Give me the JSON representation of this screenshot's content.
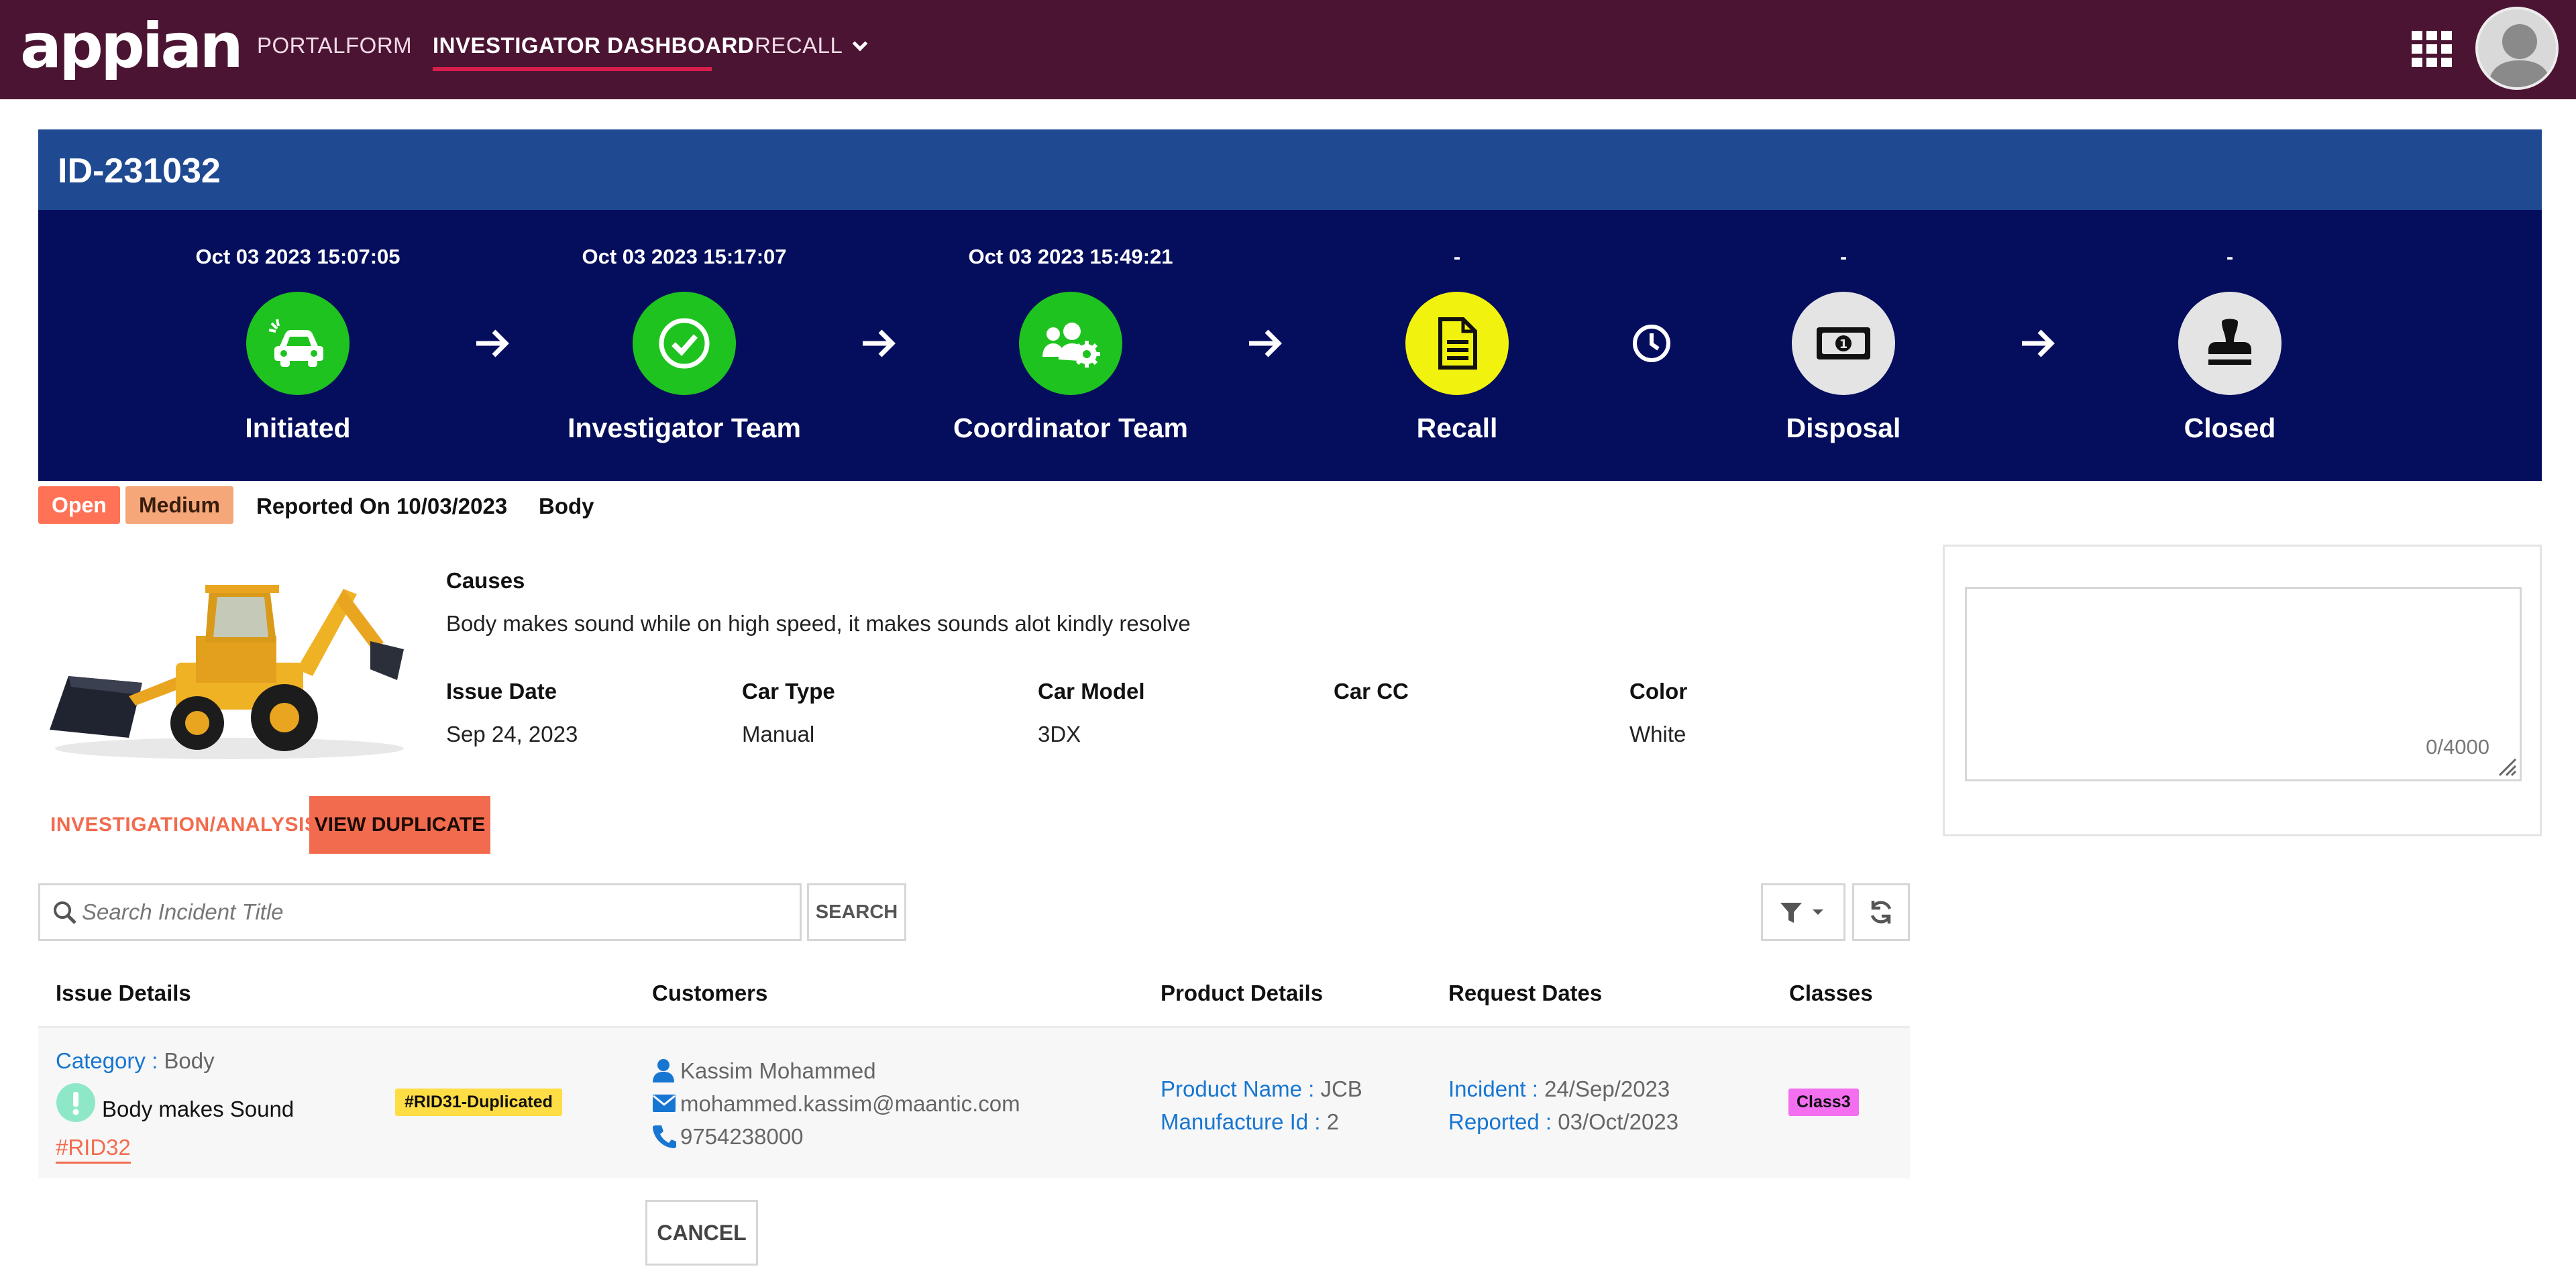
{
  "nav": {
    "logo": "appian",
    "items": [
      {
        "label": "PORTALFORM"
      },
      {
        "label": "INVESTIGATOR DASHBOARD"
      },
      {
        "label": "RECALL"
      }
    ]
  },
  "record": {
    "id": "ID-231032"
  },
  "timeline": {
    "steps": [
      {
        "date": "Oct 03 2023 15:07:05",
        "label": "Initiated",
        "icon": "car-crash-icon",
        "color": "#1fc31f"
      },
      {
        "date": "Oct 03 2023 15:17:07",
        "label": "Investigator Team",
        "icon": "check-circle-icon",
        "color": "#1fc31f"
      },
      {
        "date": "Oct 03 2023 15:49:21",
        "label": "Coordinator Team",
        "icon": "users-gear-icon",
        "color": "#1fc31f"
      },
      {
        "date": "-",
        "label": "Recall",
        "icon": "document-icon",
        "color": "#f2f20f"
      },
      {
        "date": "-",
        "label": "Disposal",
        "icon": "money-icon",
        "color": "#e4e4e4"
      },
      {
        "date": "-",
        "label": "Closed",
        "icon": "stamp-icon",
        "color": "#e4e4e4"
      }
    ]
  },
  "status": {
    "state": "Open",
    "priority": "Medium",
    "reported": "Reported On 10/03/2023",
    "category": "Body"
  },
  "details": {
    "causes_label": "Causes",
    "causes_value": "Body makes sound while on high speed, it makes sounds alot kindly resolve",
    "fields": [
      {
        "label": "Issue Date",
        "value": "Sep 24, 2023"
      },
      {
        "label": "Car Type",
        "value": "Manual"
      },
      {
        "label": "Car Model",
        "value": "3DX"
      },
      {
        "label": "Car CC",
        "value": ""
      },
      {
        "label": "Color",
        "value": "White"
      }
    ]
  },
  "comment": {
    "counter": "0/4000"
  },
  "tabs": {
    "analysis": "INVESTIGATION/ANALYSIS",
    "duplicate": "VIEW DUPLICATE"
  },
  "search": {
    "placeholder": "Search Incident Title",
    "button": "SEARCH"
  },
  "table": {
    "headers": [
      "Issue Details",
      "Customers",
      "Product Details",
      "Request Dates",
      "Classes"
    ],
    "row": {
      "category_label": "Category :",
      "category_value": "Body",
      "issue_title": "Body makes Sound",
      "rid": "#RID32",
      "duplicate_tag": "#RID31-Duplicated",
      "customer_name": "Kassim Mohammed",
      "customer_email": "mohammed.kassim@maantic.com",
      "customer_phone": "9754238000",
      "product_name_label": "Product Name :",
      "product_name_value": "JCB",
      "manufacture_label": "Manufacture Id :",
      "manufacture_value": "2",
      "incident_label": "Incident :",
      "incident_value": "24/Sep/2023",
      "reported_label": "Reported :",
      "reported_value": "03/Oct/2023",
      "class_tag": "Class3"
    }
  },
  "actions": {
    "cancel": "CANCEL"
  }
}
